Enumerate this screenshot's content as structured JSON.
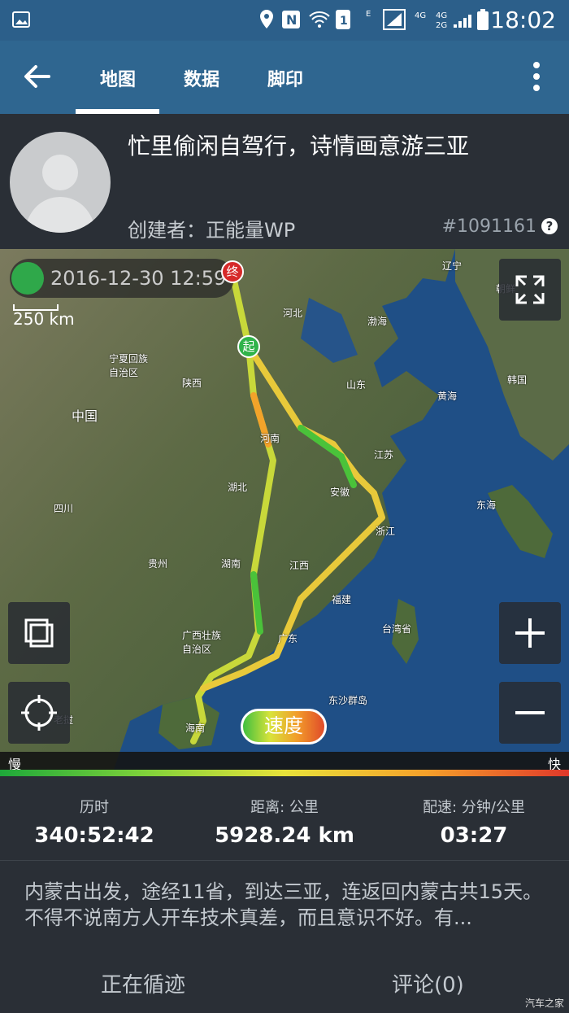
{
  "status_bar": {
    "time": "18:02",
    "icons": [
      "image-icon",
      "location-icon",
      "nfc-icon",
      "wifi-icon",
      "sim-1-icon",
      "signal-e-icon",
      "signal-4g-icon",
      "battery-icon"
    ]
  },
  "app_bar": {
    "tabs": [
      {
        "label": "地图",
        "active": true
      },
      {
        "label": "数据",
        "active": false
      },
      {
        "label": "脚印",
        "active": false
      }
    ]
  },
  "trip": {
    "title": "忙里偷闲自驾行，诗情画意游三亚",
    "creator": "创建者：正能量WP",
    "id": "#1091161"
  },
  "map": {
    "date": "2016-12-30 12:59",
    "scale": "250 km",
    "start_marker": "起",
    "end_marker": "终",
    "speed_button": "速度",
    "slow_label": "慢",
    "fast_label": "快",
    "labels": [
      {
        "text": "辽宁"
      },
      {
        "text": "朝鲜"
      },
      {
        "text": "河北"
      },
      {
        "text": "渤海"
      },
      {
        "text": "宁夏回族\n自治区"
      },
      {
        "text": "山东"
      },
      {
        "text": "陕西"
      },
      {
        "text": "韩国"
      },
      {
        "text": "黄海"
      },
      {
        "text": "中国"
      },
      {
        "text": "河南"
      },
      {
        "text": "江苏"
      },
      {
        "text": "湖北"
      },
      {
        "text": "安徽"
      },
      {
        "text": "四川"
      },
      {
        "text": "东海"
      },
      {
        "text": "浙江"
      },
      {
        "text": "贵州"
      },
      {
        "text": "湖南"
      },
      {
        "text": "江西"
      },
      {
        "text": "福建"
      },
      {
        "text": "台湾省"
      },
      {
        "text": "广西壮族\n自治区"
      },
      {
        "text": "广东"
      },
      {
        "text": "东沙群岛"
      },
      {
        "text": "老挝"
      },
      {
        "text": "海南"
      }
    ]
  },
  "stats": [
    {
      "label": "历时",
      "value": "340:52:42"
    },
    {
      "label": "距离: 公里",
      "value": "5928.24 km"
    },
    {
      "label": "配速: 分钟/公里",
      "value": "03:27"
    }
  ],
  "description": "内蒙古出发，途经11省，到达三亚，连返回内蒙古共15天。不得不说南方人开车技术真差，而且意识不好。有...",
  "footer": {
    "follow": "正在循迹",
    "comments": "评论(0)"
  },
  "watermark": "汽车之家"
}
